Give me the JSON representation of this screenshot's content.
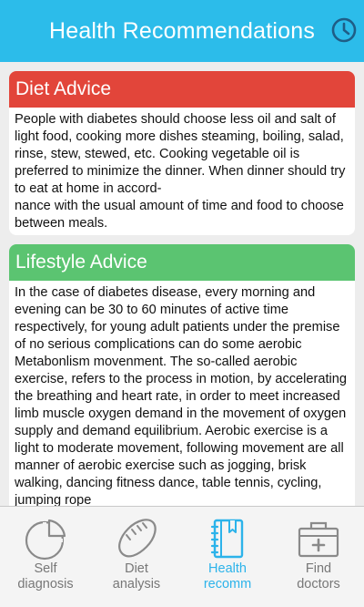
{
  "header": {
    "title": "Health Recommendations",
    "history_icon": "clock-icon"
  },
  "diet_card": {
    "title": "Diet Advice",
    "color": "#e2453a",
    "body": "People with diabetes should choose less oil and salt of light food, cooking more dishes steaming, boiling, salad, rinse, stew, stewed, etc. Cooking vegetable oil is preferred to minimize the dinner. When dinner should try to eat at home in accord-\nnance with the usual amount of time and food to choose between meals."
  },
  "lifestyle_card": {
    "title": "Lifestyle Advice",
    "color": "#5bc471",
    "body": "In the case of diabetes disease, every morning and evening can be 30 to 60 minutes of active time respectively, for young adult patients under the premise of no serious complications can do some aerobic Metabonlism movenment. The so-called aerobic exercise, refers to the process in motion, by accelerating the breathing and heart rate, in order to meet increased limb muscle oxygen demand in the movement of oxygen supply and demand equilibrium. Aerobic exercise is a light to moderate movement, following movement are all manner of aerobic exercise such as jogging, brisk walking, dancing fitness dance, table tennis, cycling, jumping rope"
  },
  "tabs": [
    {
      "line1": "Self",
      "line2": "diagnosis",
      "icon": "pie-chart-icon",
      "active": false
    },
    {
      "line1": "Diet",
      "line2": "analysis",
      "icon": "bread-icon",
      "active": false
    },
    {
      "line1": "Health",
      "line2": "recomm",
      "icon": "notebook-icon",
      "active": true
    },
    {
      "line1": "Find",
      "line2": "doctors",
      "icon": "medical-kit-icon",
      "active": false
    }
  ],
  "colors": {
    "header": "#2cbcea",
    "active_tab": "#2cb3ea",
    "inactive_tab": "#777777"
  }
}
